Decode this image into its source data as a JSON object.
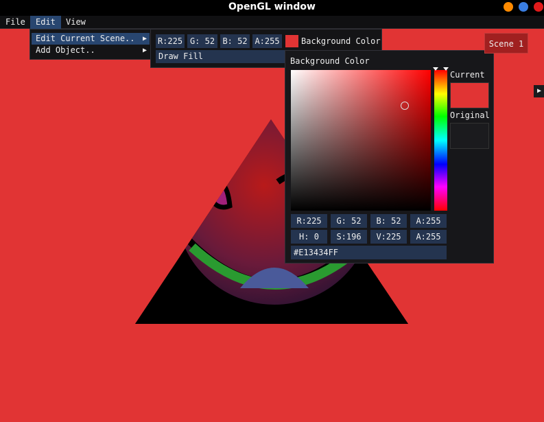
{
  "window": {
    "title": "OpenGL window",
    "controls": [
      "minimize-icon",
      "maximize-icon",
      "close-icon"
    ]
  },
  "menubar": {
    "items": [
      "File",
      "Edit",
      "View"
    ],
    "active": "Edit"
  },
  "edit_menu": {
    "items": [
      {
        "label": "Edit Current Scene..",
        "has_submenu": true,
        "highlighted": true
      },
      {
        "label": "Add Object..",
        "has_submenu": true,
        "highlighted": false
      }
    ]
  },
  "scene_submenu": {
    "fields": [
      "R:225",
      "G: 52",
      "B: 52",
      "A:255"
    ],
    "background_label": "Background Color",
    "draw_fill_label": "Draw Fill"
  },
  "color_picker": {
    "title": "Background Color",
    "current_label": "Current",
    "original_label": "Original",
    "rgba_fields": [
      "R:225",
      "G: 52",
      "B: 52",
      "A:255"
    ],
    "hsva_fields": [
      "H:  0",
      "S:196",
      "V:225",
      "A:255"
    ],
    "hex_value": "#E13434FF",
    "current_color": "#e13434",
    "original_color": "#1b1b1e"
  },
  "scene_button": {
    "label": "Scene 1"
  },
  "colors": {
    "background": "#e13434",
    "accent": "#284670",
    "field": "#24344f",
    "panel": "#141416"
  }
}
